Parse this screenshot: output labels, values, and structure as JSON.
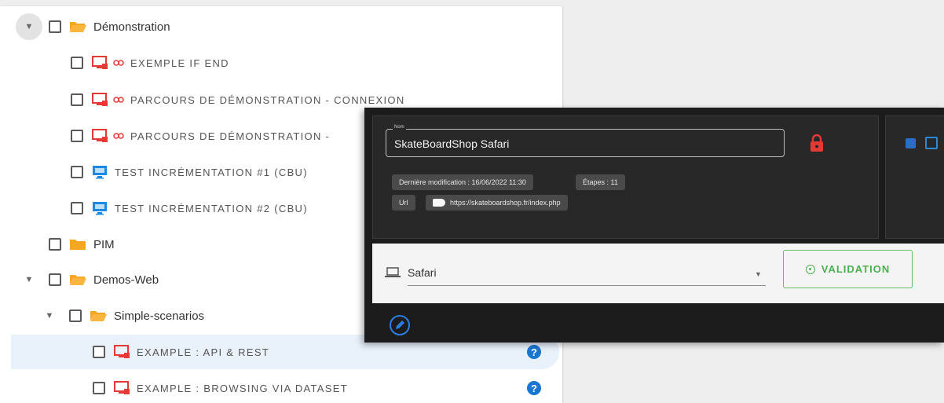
{
  "tree": {
    "rows": [
      {
        "label": "Démonstration"
      },
      {
        "label": "EXEMPLE IF END"
      },
      {
        "label": "PARCOURS DE DÉMONSTRATION - CONNEXION"
      },
      {
        "label": "PARCOURS DE DÉMONSTRATION -"
      },
      {
        "label": "TEST INCRÉMENTATION #1 (CBU)"
      },
      {
        "label": "TEST INCRÉMENTATION #2 (CBU)"
      },
      {
        "label": "PIM"
      },
      {
        "label": "Demos-Web"
      },
      {
        "label": "Simple-scenarios"
      },
      {
        "label": "EXAMPLE : API & REST"
      },
      {
        "label": "EXAMPLE : BROWSING VIA DATASET"
      }
    ],
    "help_glyph": "?"
  },
  "detail": {
    "name_legend": "Nom",
    "name_value": "SkateBoardShop Safari",
    "last_modified": "Dernière modification : 16/06/2022 11:30",
    "steps": "Étapes : 11",
    "url_label": "Url",
    "url_value": "https://skateboardshop.fr/index.php",
    "browser": "Safari",
    "validation_label": "VALIDATION"
  },
  "colors": {
    "accent": "#1976d2",
    "folder": "#f5a623",
    "monitor_red": "#e53935",
    "monitor_blue": "#1e88e5",
    "lock_red": "#e53935",
    "validation_green": "#4caf50"
  }
}
